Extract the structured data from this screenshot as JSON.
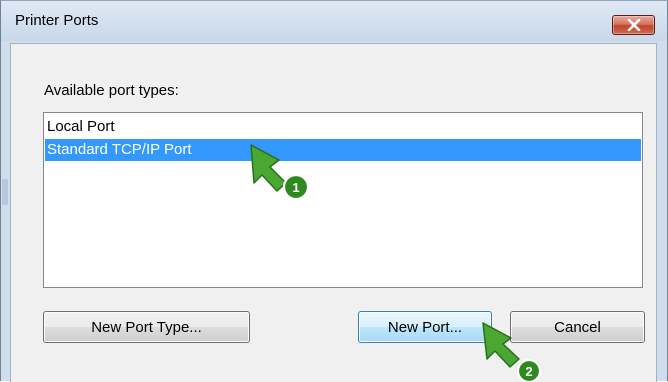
{
  "dialog": {
    "title": "Printer Ports",
    "close_label": "close",
    "group_label": "Available port types:",
    "port_types": [
      "Local Port",
      "Standard TCP/IP Port"
    ],
    "selected_index": 1,
    "buttons": {
      "new_port_type": "New Port Type...",
      "new_port": "New Port...",
      "cancel": "Cancel"
    }
  },
  "annotations": {
    "step1": "1",
    "step2": "2",
    "arrow_color": "#4aa832",
    "badge_color": "#2d8a1f"
  },
  "colors": {
    "selection": "#3399ff",
    "close_button": "#c7432b"
  },
  "icons": {
    "close": "close-x-icon",
    "pointer": "green-arrow-pointer"
  }
}
